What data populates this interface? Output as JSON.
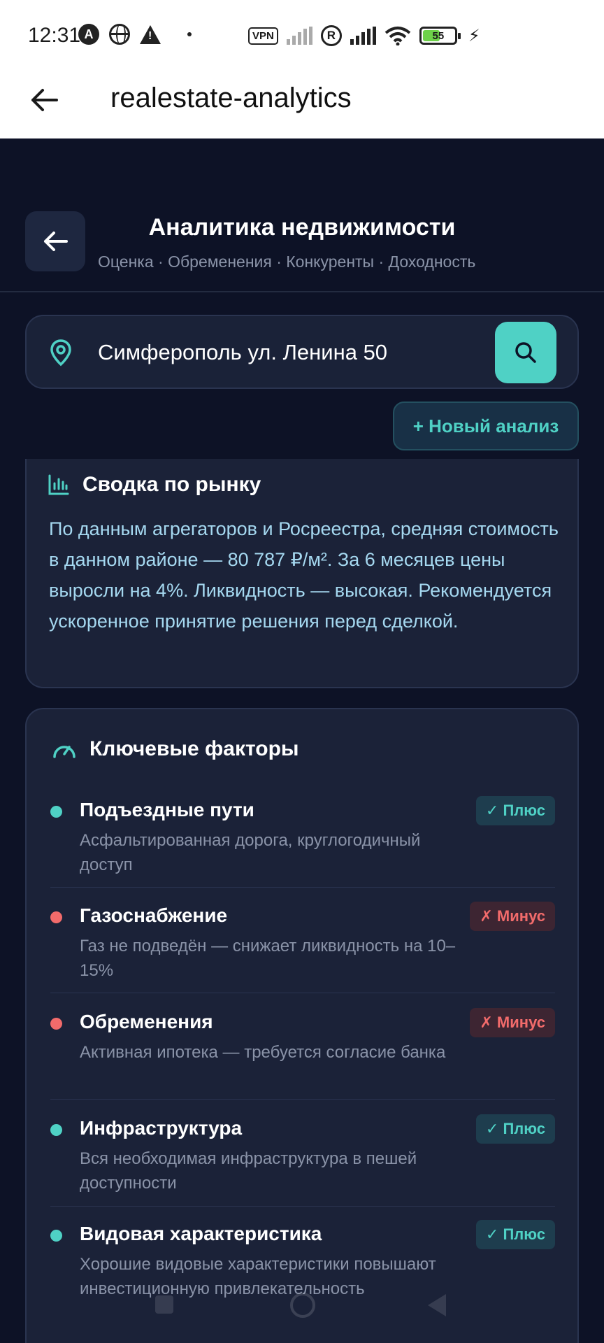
{
  "status_bar": {
    "time": "12:31",
    "vpn": "VPN",
    "r_badge": "R",
    "battery_level": "55",
    "battery_fraction": 0.55,
    "icons": [
      "a-icon",
      "globe-icon",
      "warning-icon",
      "dot-icon",
      "vpn-icon",
      "signal-icon",
      "r-icon",
      "signal-icon",
      "wifi-icon",
      "battery-icon",
      "charging-icon"
    ]
  },
  "app_bar": {
    "title": "realestate-analytics",
    "back_icon": "arrow-left-icon"
  },
  "header": {
    "title": "Аналитика недвижимости",
    "subtitle": "Оценка · Обременения · Конкуренты · Доходность",
    "back_icon": "arrow-left-icon"
  },
  "search": {
    "value": "Симферополь ул. Ленина 50",
    "pin_icon": "location-pin-icon",
    "button_icon": "search-icon"
  },
  "new_analysis_button": "+ Новый анализ",
  "summary": {
    "title": "Сводка по рынку",
    "icon": "bar-chart-icon",
    "text": "По данным агрегаторов и Росреестра, средняя стоимость в данном районе — 80 787 ₽/м². За 6 месяцев цены выросли на 4%. Ликвидность — высокая. Рекомендуется ускоренное принятие решения перед сделкой."
  },
  "factors": {
    "title": "Ключевые факторы",
    "icon": "gauge-icon",
    "items": [
      {
        "title": "Подъездные пути",
        "desc": "Асфальтированная дорога, круглогодичный доступ",
        "badge": "✓ Плюс",
        "type": "plus"
      },
      {
        "title": "Газоснабжение",
        "desc": "Газ не подведён — снижает ликвидность на 10–15%",
        "badge": "✗ Минус",
        "type": "minus"
      },
      {
        "title": "Обременения",
        "desc": "Активная ипотека — требуется согласие банка",
        "badge": "✗ Минус",
        "type": "minus"
      },
      {
        "title": "Инфраструктура",
        "desc": "Вся необходимая инфраструктура в пешей доступности",
        "badge": "✓ Плюс",
        "type": "plus"
      },
      {
        "title": "Видовая характеристика",
        "desc": "Хорошие видовые характеристики повышают инвестиционную привлекательность",
        "badge": "✓ Плюс",
        "type": "plus"
      }
    ]
  },
  "colors": {
    "background": "#0d1226",
    "card": "#1b2238",
    "accent": "#4fd1c5",
    "negative": "#f26b6b",
    "summary_text": "#a5d8f0"
  },
  "nav_bar": {
    "icons": [
      "recents-icon",
      "home-icon",
      "back-icon"
    ]
  }
}
